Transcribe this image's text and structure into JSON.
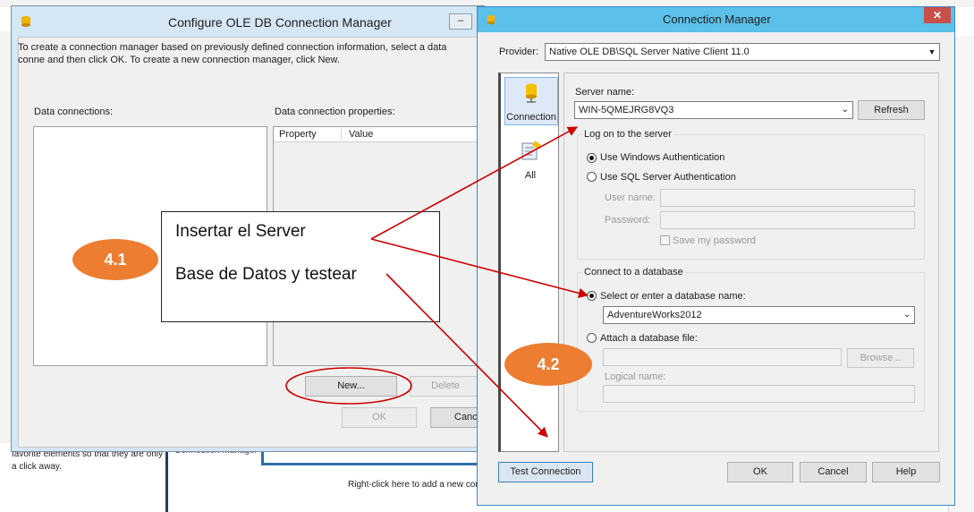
{
  "background": {
    "left_text": "favorite elements so that they are only a click away.",
    "cut_text": "Connection Manager",
    "right_click_text": "Right-click here to add a new conn"
  },
  "configure_window": {
    "title": "Configure OLE DB Connection Manager",
    "minimize_glyph": "–",
    "intro_text": "To create a connection manager based on previously defined connection information, select a data conne and then click OK. To create a new connection manager, click New.",
    "data_connections_label": "Data connections:",
    "data_connection_properties_label": "Data connection properties:",
    "property_header": "Property",
    "value_header": "Value",
    "new_button": "New...",
    "delete_button": "Delete",
    "ok_button": "OK",
    "cancel_button": "Canc"
  },
  "callout": {
    "line1": "Insertar el Server",
    "line2": "Base de Datos y testear"
  },
  "badges": {
    "step1": "4.1",
    "step2": "4.2"
  },
  "connection_manager": {
    "title": "Connection Manager",
    "close_glyph": "✕",
    "provider_label": "Provider:",
    "provider_value": "Native OLE DB\\SQL Server Native Client 11.0",
    "nav": {
      "connection": "Connection",
      "all": "All"
    },
    "server_name_label": "Server name:",
    "server_name_value": "WIN-5QMEJRG8VQ3",
    "refresh_button": "Refresh",
    "logon_group_label": "Log on to the server",
    "use_windows_auth": "Use Windows Authentication",
    "use_sql_auth": "Use SQL Server Authentication",
    "user_name_label": "User name:",
    "password_label": "Password:",
    "save_password_label": "Save my password",
    "connect_db_group_label": "Connect to a database",
    "select_db_label": "Select or enter a database name:",
    "db_value": "AdventureWorks2012",
    "attach_db_label": "Attach a database file:",
    "browse_button": "Browse...",
    "logical_name_label": "Logical name:",
    "test_connection_button": "Test Connection",
    "ok_button": "OK",
    "cancel_button": "Cancel",
    "help_button": "Help"
  },
  "colors": {
    "annotation_red": "#cc0000",
    "badge_orange": "#ed7d31",
    "title_blue": "#5bc0ea"
  }
}
